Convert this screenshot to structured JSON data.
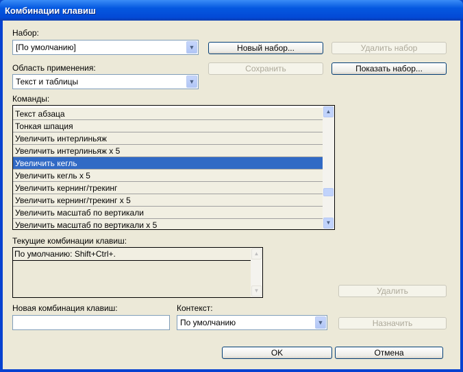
{
  "title": "Комбинации клавиш",
  "set": {
    "label": "Набор:",
    "value": "[По умолчанию]"
  },
  "scope": {
    "label": "Область применения:",
    "value": "Текст и таблицы"
  },
  "buttons": {
    "new_set": "Новый набор...",
    "delete_set": "Удалить набор",
    "save": "Сохранить",
    "show_set": "Показать набор...",
    "delete": "Удалить",
    "assign": "Назначить",
    "ok": "OK",
    "cancel": "Отмена"
  },
  "commands": {
    "label": "Команды:",
    "items": [
      "Текст абзаца",
      "Тонкая шпация",
      "Увеличить интерлиньяж",
      "Увеличить интерлиньяж x 5",
      "Увеличить кегль",
      "Увеличить кегль x 5",
      "Увеличить кернинг/трекинг",
      "Увеличить кернинг/трекинг x 5",
      "Увеличить масштаб по вертикали",
      "Увеличить масштаб по вертикали x 5"
    ],
    "selected": "Увеличить кегль"
  },
  "current": {
    "label": "Текущие комбинации клавиш:",
    "items": [
      "По умолчанию: Shift+Ctrl+."
    ]
  },
  "new_shortcut": {
    "label": "Новая комбинация клавиш:",
    "value": ""
  },
  "context": {
    "label": "Контекст:",
    "value": "По умолчанию"
  }
}
